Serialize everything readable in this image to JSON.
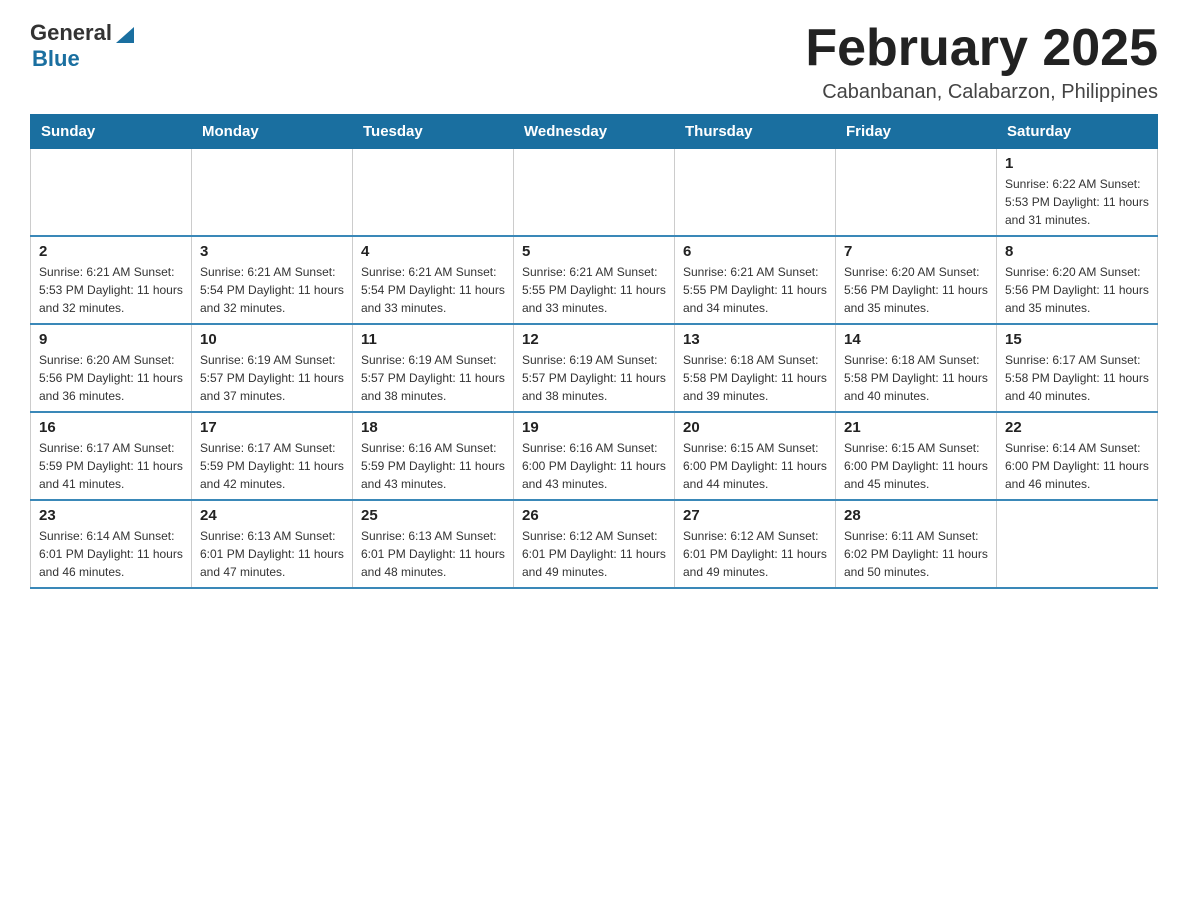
{
  "header": {
    "title": "February 2025",
    "subtitle": "Cabanbanan, Calabarzon, Philippines"
  },
  "logo": {
    "line1": "General",
    "line2": "Blue"
  },
  "days_of_week": [
    "Sunday",
    "Monday",
    "Tuesday",
    "Wednesday",
    "Thursday",
    "Friday",
    "Saturday"
  ],
  "weeks": [
    [
      {
        "date": "",
        "info": ""
      },
      {
        "date": "",
        "info": ""
      },
      {
        "date": "",
        "info": ""
      },
      {
        "date": "",
        "info": ""
      },
      {
        "date": "",
        "info": ""
      },
      {
        "date": "",
        "info": ""
      },
      {
        "date": "1",
        "info": "Sunrise: 6:22 AM\nSunset: 5:53 PM\nDaylight: 11 hours and 31 minutes."
      }
    ],
    [
      {
        "date": "2",
        "info": "Sunrise: 6:21 AM\nSunset: 5:53 PM\nDaylight: 11 hours and 32 minutes."
      },
      {
        "date": "3",
        "info": "Sunrise: 6:21 AM\nSunset: 5:54 PM\nDaylight: 11 hours and 32 minutes."
      },
      {
        "date": "4",
        "info": "Sunrise: 6:21 AM\nSunset: 5:54 PM\nDaylight: 11 hours and 33 minutes."
      },
      {
        "date": "5",
        "info": "Sunrise: 6:21 AM\nSunset: 5:55 PM\nDaylight: 11 hours and 33 minutes."
      },
      {
        "date": "6",
        "info": "Sunrise: 6:21 AM\nSunset: 5:55 PM\nDaylight: 11 hours and 34 minutes."
      },
      {
        "date": "7",
        "info": "Sunrise: 6:20 AM\nSunset: 5:56 PM\nDaylight: 11 hours and 35 minutes."
      },
      {
        "date": "8",
        "info": "Sunrise: 6:20 AM\nSunset: 5:56 PM\nDaylight: 11 hours and 35 minutes."
      }
    ],
    [
      {
        "date": "9",
        "info": "Sunrise: 6:20 AM\nSunset: 5:56 PM\nDaylight: 11 hours and 36 minutes."
      },
      {
        "date": "10",
        "info": "Sunrise: 6:19 AM\nSunset: 5:57 PM\nDaylight: 11 hours and 37 minutes."
      },
      {
        "date": "11",
        "info": "Sunrise: 6:19 AM\nSunset: 5:57 PM\nDaylight: 11 hours and 38 minutes."
      },
      {
        "date": "12",
        "info": "Sunrise: 6:19 AM\nSunset: 5:57 PM\nDaylight: 11 hours and 38 minutes."
      },
      {
        "date": "13",
        "info": "Sunrise: 6:18 AM\nSunset: 5:58 PM\nDaylight: 11 hours and 39 minutes."
      },
      {
        "date": "14",
        "info": "Sunrise: 6:18 AM\nSunset: 5:58 PM\nDaylight: 11 hours and 40 minutes."
      },
      {
        "date": "15",
        "info": "Sunrise: 6:17 AM\nSunset: 5:58 PM\nDaylight: 11 hours and 40 minutes."
      }
    ],
    [
      {
        "date": "16",
        "info": "Sunrise: 6:17 AM\nSunset: 5:59 PM\nDaylight: 11 hours and 41 minutes."
      },
      {
        "date": "17",
        "info": "Sunrise: 6:17 AM\nSunset: 5:59 PM\nDaylight: 11 hours and 42 minutes."
      },
      {
        "date": "18",
        "info": "Sunrise: 6:16 AM\nSunset: 5:59 PM\nDaylight: 11 hours and 43 minutes."
      },
      {
        "date": "19",
        "info": "Sunrise: 6:16 AM\nSunset: 6:00 PM\nDaylight: 11 hours and 43 minutes."
      },
      {
        "date": "20",
        "info": "Sunrise: 6:15 AM\nSunset: 6:00 PM\nDaylight: 11 hours and 44 minutes."
      },
      {
        "date": "21",
        "info": "Sunrise: 6:15 AM\nSunset: 6:00 PM\nDaylight: 11 hours and 45 minutes."
      },
      {
        "date": "22",
        "info": "Sunrise: 6:14 AM\nSunset: 6:00 PM\nDaylight: 11 hours and 46 minutes."
      }
    ],
    [
      {
        "date": "23",
        "info": "Sunrise: 6:14 AM\nSunset: 6:01 PM\nDaylight: 11 hours and 46 minutes."
      },
      {
        "date": "24",
        "info": "Sunrise: 6:13 AM\nSunset: 6:01 PM\nDaylight: 11 hours and 47 minutes."
      },
      {
        "date": "25",
        "info": "Sunrise: 6:13 AM\nSunset: 6:01 PM\nDaylight: 11 hours and 48 minutes."
      },
      {
        "date": "26",
        "info": "Sunrise: 6:12 AM\nSunset: 6:01 PM\nDaylight: 11 hours and 49 minutes."
      },
      {
        "date": "27",
        "info": "Sunrise: 6:12 AM\nSunset: 6:01 PM\nDaylight: 11 hours and 49 minutes."
      },
      {
        "date": "28",
        "info": "Sunrise: 6:11 AM\nSunset: 6:02 PM\nDaylight: 11 hours and 50 minutes."
      },
      {
        "date": "",
        "info": ""
      }
    ]
  ]
}
